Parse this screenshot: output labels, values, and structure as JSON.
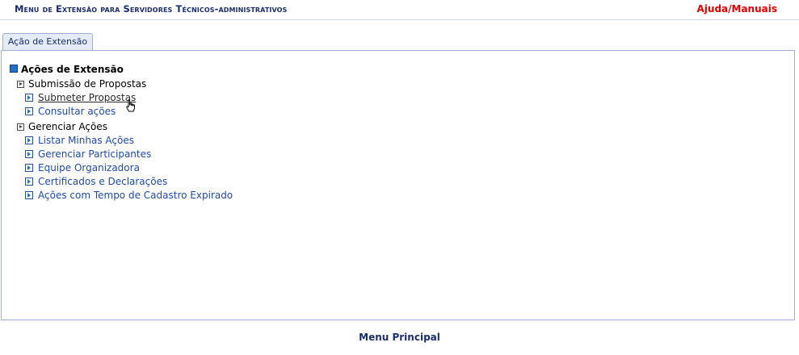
{
  "header": {
    "title": "Menu de Extensão para Servidores Técnicos-administrativos",
    "help_label": "Ajuda/Manuais"
  },
  "tabs": [
    {
      "label": "Ação de Extensão",
      "active": true
    }
  ],
  "menu": {
    "root_label": "Ações de Extensão",
    "groups": [
      {
        "label": "Submissão de Propostas",
        "items": [
          {
            "label": "Submeter Propostas"
          },
          {
            "label": "Consultar ações"
          }
        ]
      },
      {
        "label": "Gerenciar Ações",
        "items": [
          {
            "label": "Listar Minhas Ações"
          },
          {
            "label": "Gerenciar Participantes"
          },
          {
            "label": "Equipe Organizadora"
          },
          {
            "label": "Certificados e Declarações"
          },
          {
            "label": "Ações com Tempo de Cadastro Expirado"
          }
        ]
      }
    ]
  },
  "footer": {
    "main_menu_label": "Menu Principal"
  },
  "colors": {
    "title": "#1a2e6b",
    "help_link": "#e30000",
    "link": "#1f4aa8",
    "tab_bg": "#e3ebf7",
    "border": "#9db0d0"
  },
  "icons": {
    "root": "expand-square-icon",
    "group": "arrow-square-icon",
    "item": "arrow-square-icon",
    "pointer": "hand-cursor-icon"
  }
}
